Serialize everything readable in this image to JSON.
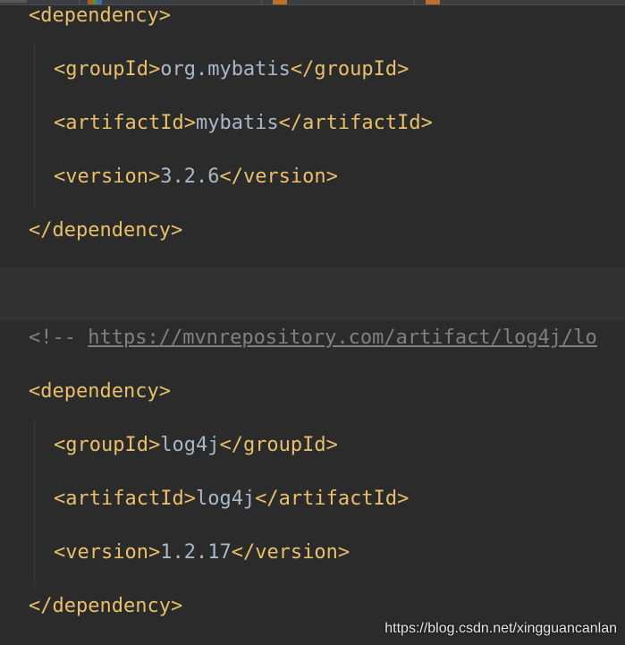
{
  "editor": {
    "lines": [
      {
        "indent": 1,
        "kind": "tag",
        "text": "<dependency>"
      },
      {
        "indent": 2,
        "kind": "element",
        "open": "<groupId>",
        "value": "org.mybatis",
        "close": "</groupId>"
      },
      {
        "indent": 2,
        "kind": "element",
        "open": "<artifactId>",
        "value": "mybatis",
        "close": "</artifactId>"
      },
      {
        "indent": 2,
        "kind": "element",
        "open": "<version>",
        "value": "3.2.6",
        "close": "</version>"
      },
      {
        "indent": 1,
        "kind": "tag",
        "text": "</dependency>"
      },
      {
        "indent": 0,
        "kind": "blank",
        "text": ""
      },
      {
        "indent": 1,
        "kind": "comment",
        "prefix": "<!-- ",
        "url": "https://mvnrepository.com/artifact/log4j/lo"
      },
      {
        "indent": 1,
        "kind": "tag",
        "text": "<dependency>"
      },
      {
        "indent": 2,
        "kind": "element",
        "open": "<groupId>",
        "value": "log4j",
        "close": "</groupId>"
      },
      {
        "indent": 2,
        "kind": "element",
        "open": "<artifactId>",
        "value": "log4j",
        "close": "</artifactId>"
      },
      {
        "indent": 2,
        "kind": "element",
        "open": "<version>",
        "value": "1.2.17",
        "close": "</version>"
      },
      {
        "indent": 1,
        "kind": "tag",
        "text": "</dependency>"
      }
    ],
    "current_line": 5
  },
  "watermark": "https://blog.csdn.net/xingguancanlan",
  "colors": {
    "background": "#2b2b2b",
    "tag": "#e8bf6a",
    "text": "#a9b7c6",
    "comment": "#808080",
    "current_line": "#323232"
  }
}
